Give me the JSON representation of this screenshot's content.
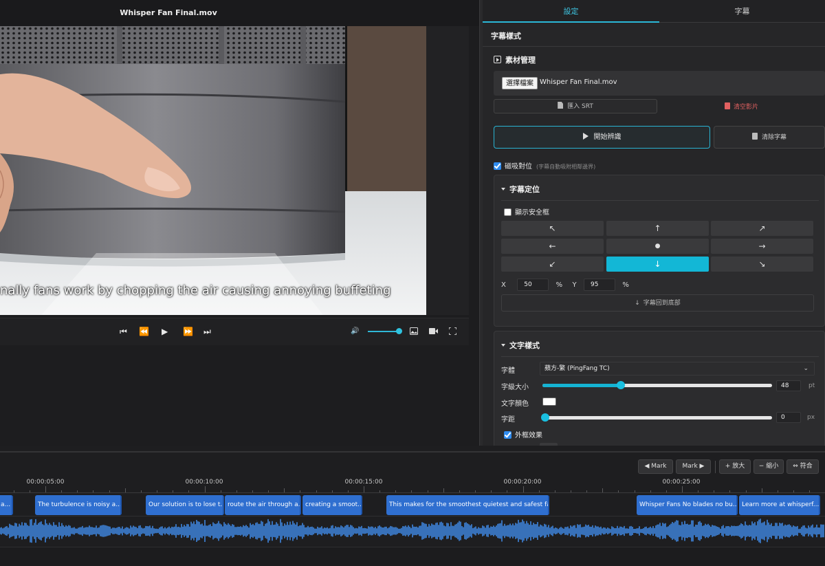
{
  "window": {
    "title": "Whisper Fan Final.mov"
  },
  "video": {
    "subtitle": "nally fans work by chopping the air causing annoying buffeting"
  },
  "player": {
    "controls": [
      "⏮",
      "⏪",
      "▶",
      "⏩",
      "⏭"
    ],
    "volume_icon": "🔊",
    "volume_level": 0.98,
    "right_icons": [
      "image-icon",
      "camera-icon",
      "fullscreen-icon"
    ]
  },
  "tabs": [
    {
      "label": "設定",
      "active": true
    },
    {
      "label": "字幕",
      "active": false
    }
  ],
  "panel": {
    "section_title": "字幕樣式",
    "asset": {
      "heading": "素材管理",
      "choose_file": "選擇檔案",
      "file_name": "Whisper Fan Final.mov",
      "import_srt": "匯入 SRT",
      "clear_video": "清空影片"
    },
    "start_recognition": "開始辨識",
    "clear_subtitles": "清除字幕",
    "snap": {
      "label": "磁吸對位",
      "hint": "(字幕自動吸附相鄰邊界)",
      "checked": true
    },
    "position": {
      "heading": "字幕定位",
      "show_safe": "顯示安全框",
      "grid": [
        "↖",
        "↑",
        "↗",
        "←",
        "●",
        "→",
        "↙",
        "↓",
        "↘"
      ],
      "active_index": 7,
      "x_label": "X",
      "x_value": "50",
      "x_unit": "%",
      "y_label": "Y",
      "y_value": "95",
      "y_unit": "%",
      "reset_bottom": "字幕回到底部"
    },
    "text_style": {
      "heading": "文字樣式",
      "font_label": "字體",
      "font_value": "蘋方-繁 (PingFang TC)",
      "size_label": "字級大小",
      "size_value": "48",
      "size_unit": "pt",
      "size_fraction": 0.34,
      "color_label": "文字顏色",
      "color_value": "#ffffff",
      "spacing_label": "字距",
      "spacing_value": "0",
      "spacing_unit": "px",
      "spacing_fraction": 0,
      "border_label": "外框效果",
      "border_checked": true
    }
  },
  "timeline": {
    "buttons": [
      "◀ Mark",
      "Mark ▶",
      "+ 放大",
      "− 縮小",
      "⇔ 符合"
    ],
    "ticks": [
      "00:00:05:00",
      "00:00:10:00",
      "00:00:15:00",
      "00:00:20:00",
      "00:00:25:00"
    ],
    "clips": [
      "Dyson a...",
      "The turbulence is noisy a...",
      "Our solution is to lose t...",
      "route the air through a...",
      "creating a smoot...",
      "This makes for the smoothest quietest and safest fa...",
      "Whisper Fans No blades no bu...",
      "Learn more at whisperf..."
    ]
  },
  "colors": {
    "accent": "#13b7d6",
    "clip": "#2f6fd0",
    "wave": "#3f86e0",
    "danger": "#e26060"
  }
}
